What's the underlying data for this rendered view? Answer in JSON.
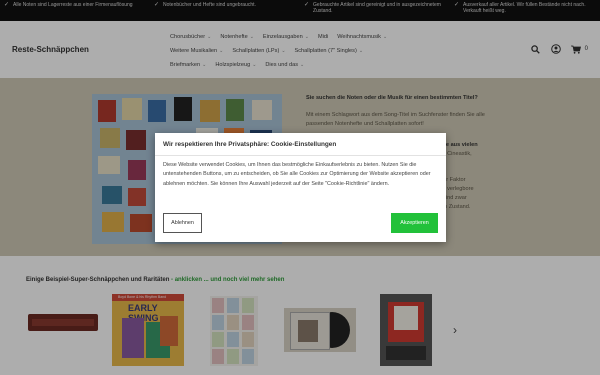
{
  "topbar": {
    "items": [
      {
        "icon": "check-icon",
        "text": "Alle Noten sind Lagerreste aus einer Firmenauflösung"
      },
      {
        "icon": "check-icon",
        "text": "Notenbücher und Hefte sind ungebraucht."
      },
      {
        "icon": "check-icon",
        "text": "Gebrauchte Artikel sind gereinigt und in ausgezeichnetem Zustand."
      },
      {
        "icon": "check-icon",
        "text": "Ausverkauf aller Artikel. Wir füllen Bestände nicht nach. Verkauft heißt weg."
      }
    ]
  },
  "header": {
    "logo": "Reste-Schnäppchen",
    "nav": [
      [
        "Chorusbücher",
        "Notenhefte",
        "Einzelausgaben",
        "Midi",
        "Weihnachtsmusik"
      ],
      [
        "Weitere Musikalien",
        "Schallplatten (LPs)",
        "Schallplatten (7\" Singles)"
      ],
      [
        "Briefmarken",
        "Holzspielzeug",
        "Dies und das"
      ]
    ],
    "nav_chevrons": [
      [
        true,
        true,
        true,
        false,
        true
      ],
      [
        true,
        true,
        true
      ],
      [
        true,
        true,
        true
      ]
    ],
    "icons": [
      "search-icon",
      "user-icon",
      "cart-icon"
    ],
    "cart_count": "0"
  },
  "hero": {
    "heading": "Sie suchen die Noten oder die Musik für einen bestimmten Titel?",
    "text1": "Mit einem Schlagwort aus dem Song-Titel im Suchfenster finden Sie alle passenden Notenhefte und Schallplatten sofort!",
    "line_a": "erstücke aus vielen",
    "line_b": "artikeln, Cineastik,",
    "line_c": "wichtiger Faktor",
    "line_d": "r für Sie verlegbore",
    "line_e": "Artikel sind zwar",
    "line_f": "einigtem Zustand."
  },
  "products": {
    "title": "Einige Beispiel-Super-Schnäppchen und Raritäten",
    "link": " - anklicken ... und noch viel mehr sehen",
    "items": [
      {
        "name": "case-product-image"
      },
      {
        "name": "early-swing-album-image",
        "label": "EARLY SWING",
        "sub": "Boyd Bone & his Rhythm Band"
      },
      {
        "name": "sheet-music-collage-image"
      },
      {
        "name": "vinyl-record-image"
      },
      {
        "name": "red-flag-poster-image"
      }
    ]
  },
  "cookie": {
    "title": "Wir respektieren Ihre Privatsphäre: Cookie-Einstellungen",
    "body": "Diese Website verwendet Cookies, um Ihnen das bestmögliche Einkaufserlebnis zu bieten. Nutzen Sie die untenstehenden Buttons, um zu entscheiden, ob Sie alle Cookies zur Optimierung der Website akzeptieren oder ablehnen möchten. Sie können Ihre Auswahl jederzeit auf der Seite \"Cookie-Richtlinie\" ändern.",
    "decline": "Ablehnen",
    "accept": "Akzeptieren"
  },
  "colors": {
    "topbar": "#111111",
    "hero_bg": "#cfc9b5",
    "accent_green": "#22c13a",
    "link_green": "#2e9c3a"
  }
}
